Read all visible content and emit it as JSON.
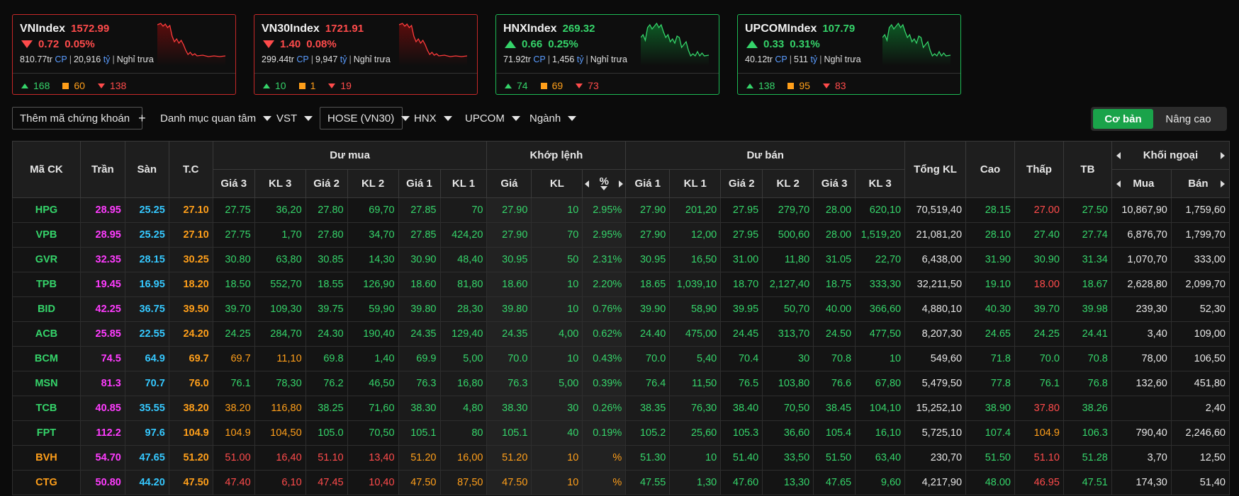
{
  "indices": [
    {
      "name": "VNIndex",
      "value": "1572.99",
      "change": "0.72",
      "pct": "0.05%",
      "dir": "down",
      "vol": "810.77tr",
      "cp": "CP",
      "val": "20,916",
      "unit": "tỷ",
      "status": "Nghỉ trưa",
      "up": "168",
      "flat": "60",
      "down": "138"
    },
    {
      "name": "VN30Index",
      "value": "1721.91",
      "change": "1.40",
      "pct": "0.08%",
      "dir": "down",
      "vol": "299.44tr",
      "cp": "CP",
      "val": "9,947",
      "unit": "tỷ",
      "status": "Nghỉ trưa",
      "up": "10",
      "flat": "1",
      "down": "19"
    },
    {
      "name": "HNXIndex",
      "value": "269.32",
      "change": "0.66",
      "pct": "0.25%",
      "dir": "up",
      "vol": "71.92tr",
      "cp": "CP",
      "val": "1,456",
      "unit": "tỷ",
      "status": "Nghỉ trưa",
      "up": "74",
      "flat": "69",
      "down": "73"
    },
    {
      "name": "UPCOMIndex",
      "value": "107.79",
      "change": "0.33",
      "pct": "0.31%",
      "dir": "up",
      "vol": "40.12tr",
      "cp": "CP",
      "val": "511",
      "unit": "tỷ",
      "status": "Nghỉ trưa",
      "up": "138",
      "flat": "95",
      "down": "83"
    }
  ],
  "toolbar": {
    "add": "Thêm mã chứng khoán",
    "watch": "Danh mục quan tâm",
    "vst": "VST",
    "hose": "HOSE (VN30)",
    "hnx": "HNX",
    "upcom": "UPCOM",
    "sector": "Ngành",
    "basic": "Cơ bản",
    "advanced": "Nâng cao"
  },
  "headers": {
    "symbol": "Mã CK",
    "ceil": "Trần",
    "floor": "Sàn",
    "ref": "T.C",
    "buy": "Dư mua",
    "match": "Khớp lệnh",
    "sell": "Dư bán",
    "total": "Tổng KL",
    "high": "Cao",
    "low": "Thấp",
    "avg": "TB",
    "foreign": "Khối ngoại",
    "p3": "Giá 3",
    "v3": "KL 3",
    "p2": "Giá 2",
    "v2": "KL 2",
    "p1": "Giá 1",
    "v1": "KL 1",
    "mp": "Giá",
    "mv": "KL",
    "pct": "%",
    "fbuy": "Mua",
    "fsell": "Bán"
  },
  "colors": {
    "ceil": "#ff3cff",
    "floor": "#35c8ff",
    "ref": "#ff9f1a",
    "up": "#35d46a",
    "down": "#ff4b4b"
  },
  "rows": [
    {
      "sym": "HPG",
      "c": "28.95",
      "f": "25.25",
      "r": "27.10",
      "b3": "27.75",
      "bv3": "36,20",
      "b2": "27.80",
      "bv2": "69,70",
      "b1": "27.85",
      "bv1": "70",
      "mp": "27.90",
      "mv": "10",
      "pct": "2.95%",
      "s1": "27.90",
      "sv1": "201,20",
      "s2": "27.95",
      "sv2": "279,70",
      "s3": "28.00",
      "sv3": "620,10",
      "tot": "70,519,40",
      "hi": "28.15",
      "lo": "27.00",
      "avg": "27.50",
      "fb": "10,867,90",
      "fs": "1,759,60",
      "col": [
        "u",
        "u",
        "u",
        "u",
        "u",
        "u",
        "u",
        "u",
        "u",
        "u",
        "u",
        "u",
        "u",
        "u",
        "u",
        "u",
        "u",
        "d",
        "u"
      ]
    },
    {
      "sym": "VPB",
      "c": "28.95",
      "f": "25.25",
      "r": "27.10",
      "b3": "27.75",
      "bv3": "1,70",
      "b2": "27.80",
      "bv2": "34,70",
      "b1": "27.85",
      "bv1": "424,20",
      "mp": "27.90",
      "mv": "70",
      "pct": "2.95%",
      "s1": "27.90",
      "sv1": "12,00",
      "s2": "27.95",
      "sv2": "500,60",
      "s3": "28.00",
      "sv3": "1,519,20",
      "tot": "21,081,20",
      "hi": "28.10",
      "lo": "27.40",
      "avg": "27.74",
      "col": [
        "u",
        "u",
        "u",
        "u",
        "u",
        "u",
        "u",
        "u",
        "u",
        "u",
        "u",
        "u",
        "u",
        "u",
        "u",
        "u",
        "u",
        "u",
        "u"
      ],
      "fb": "6,876,70",
      "fs": "1,799,70"
    },
    {
      "sym": "GVR",
      "c": "32.35",
      "f": "28.15",
      "r": "30.25",
      "b3": "30.80",
      "bv3": "63,80",
      "b2": "30.85",
      "bv2": "14,30",
      "b1": "30.90",
      "bv1": "48,40",
      "mp": "30.95",
      "mv": "50",
      "pct": "2.31%",
      "s1": "30.95",
      "sv1": "16,50",
      "s2": "31.00",
      "sv2": "11,80",
      "s3": "31.05",
      "sv3": "22,70",
      "tot": "6,438,00",
      "hi": "31.90",
      "lo": "30.90",
      "avg": "31.34",
      "fb": "1,070,70",
      "fs": "333,00",
      "col": [
        "u",
        "u",
        "u",
        "u",
        "u",
        "u",
        "u",
        "u",
        "u",
        "u",
        "u",
        "u",
        "u",
        "u",
        "u",
        "u",
        "u",
        "u",
        "u"
      ]
    },
    {
      "sym": "TPB",
      "c": "19.45",
      "f": "16.95",
      "r": "18.20",
      "b3": "18.50",
      "bv3": "552,70",
      "b2": "18.55",
      "bv2": "126,90",
      "b1": "18.60",
      "bv1": "81,80",
      "mp": "18.60",
      "mv": "10",
      "pct": "2.20%",
      "s1": "18.65",
      "sv1": "1,039,10",
      "s2": "18.70",
      "sv2": "2,127,40",
      "s3": "18.75",
      "sv3": "333,30",
      "tot": "32,211,50",
      "hi": "19.10",
      "lo": "18.00",
      "avg": "18.67",
      "fb": "2,628,80",
      "fs": "2,099,70",
      "col": [
        "u",
        "u",
        "u",
        "u",
        "u",
        "u",
        "u",
        "u",
        "u",
        "u",
        "u",
        "u",
        "u",
        "u",
        "u",
        "u",
        "u",
        "d",
        "u"
      ]
    },
    {
      "sym": "BID",
      "c": "42.25",
      "f": "36.75",
      "r": "39.50",
      "b3": "39.70",
      "bv3": "109,30",
      "b2": "39.75",
      "bv2": "59,90",
      "b1": "39.80",
      "bv1": "28,30",
      "mp": "39.80",
      "mv": "10",
      "pct": "0.76%",
      "s1": "39.90",
      "sv1": "58,90",
      "s2": "39.95",
      "sv2": "50,70",
      "s3": "40.00",
      "sv3": "366,60",
      "tot": "4,880,10",
      "hi": "40.30",
      "lo": "39.70",
      "avg": "39.98",
      "fb": "239,30",
      "fs": "52,30",
      "col": [
        "u",
        "u",
        "u",
        "u",
        "u",
        "u",
        "u",
        "u",
        "u",
        "u",
        "u",
        "u",
        "u",
        "u",
        "u",
        "u",
        "u",
        "u",
        "u"
      ]
    },
    {
      "sym": "ACB",
      "c": "25.85",
      "f": "22.55",
      "r": "24.20",
      "b3": "24.25",
      "bv3": "284,70",
      "b2": "24.30",
      "bv2": "190,40",
      "b1": "24.35",
      "bv1": "129,40",
      "mp": "24.35",
      "mv": "4,00",
      "pct": "0.62%",
      "s1": "24.40",
      "sv1": "475,00",
      "s2": "24.45",
      "sv2": "313,70",
      "s3": "24.50",
      "sv3": "477,50",
      "tot": "8,207,30",
      "hi": "24.65",
      "lo": "24.25",
      "avg": "24.41",
      "fb": "3,40",
      "fs": "109,00",
      "col": [
        "u",
        "u",
        "u",
        "u",
        "u",
        "u",
        "u",
        "u",
        "u",
        "u",
        "u",
        "u",
        "u",
        "u",
        "u",
        "u",
        "u",
        "u",
        "u"
      ]
    },
    {
      "sym": "BCM",
      "c": "74.5",
      "f": "64.9",
      "r": "69.7",
      "b3": "69.7",
      "bv3": "11,10",
      "b2": "69.8",
      "bv2": "1,40",
      "b1": "69.9",
      "bv1": "5,00",
      "mp": "70.0",
      "mv": "10",
      "pct": "0.43%",
      "s1": "70.0",
      "sv1": "5,40",
      "s2": "70.4",
      "sv2": "30",
      "s3": "70.8",
      "sv3": "10",
      "tot": "549,60",
      "hi": "71.8",
      "lo": "70.0",
      "avg": "70.8",
      "fb": "78,00",
      "fs": "106,50",
      "col": [
        "r",
        "r",
        "u",
        "u",
        "u",
        "u",
        "u",
        "u",
        "u",
        "u",
        "u",
        "u",
        "u",
        "u",
        "u",
        "u",
        "u",
        "u",
        "u"
      ]
    },
    {
      "sym": "MSN",
      "c": "81.3",
      "f": "70.7",
      "r": "76.0",
      "b3": "76.1",
      "bv3": "78,30",
      "b2": "76.2",
      "bv2": "46,50",
      "b1": "76.3",
      "bv1": "16,80",
      "mp": "76.3",
      "mv": "5,00",
      "pct": "0.39%",
      "s1": "76.4",
      "sv1": "11,50",
      "s2": "76.5",
      "sv2": "103,80",
      "s3": "76.6",
      "sv3": "67,80",
      "tot": "5,479,50",
      "hi": "77.8",
      "lo": "76.1",
      "avg": "76.8",
      "fb": "132,60",
      "fs": "451,80",
      "col": [
        "u",
        "u",
        "u",
        "u",
        "u",
        "u",
        "u",
        "u",
        "u",
        "u",
        "u",
        "u",
        "u",
        "u",
        "u",
        "u",
        "u",
        "u",
        "u"
      ]
    },
    {
      "sym": "TCB",
      "c": "40.85",
      "f": "35.55",
      "r": "38.20",
      "b3": "38.20",
      "bv3": "116,80",
      "b2": "38.25",
      "bv2": "71,60",
      "b1": "38.30",
      "bv1": "4,80",
      "mp": "38.30",
      "mv": "30",
      "pct": "0.26%",
      "s1": "38.35",
      "sv1": "76,30",
      "s2": "38.40",
      "sv2": "70,50",
      "s3": "38.45",
      "sv3": "104,10",
      "tot": "15,252,10",
      "hi": "38.90",
      "lo": "37.80",
      "avg": "38.26",
      "fb": "",
      "fs": "2,40",
      "col": [
        "r",
        "r",
        "u",
        "u",
        "u",
        "u",
        "u",
        "u",
        "u",
        "u",
        "u",
        "u",
        "u",
        "u",
        "u",
        "u",
        "u",
        "d",
        "u"
      ]
    },
    {
      "sym": "FPT",
      "c": "112.2",
      "f": "97.6",
      "r": "104.9",
      "b3": "104.9",
      "bv3": "104,50",
      "b2": "105.0",
      "bv2": "70,50",
      "b1": "105.1",
      "bv1": "80",
      "mp": "105.1",
      "mv": "40",
      "pct": "0.19%",
      "s1": "105.2",
      "sv1": "25,60",
      "s2": "105.3",
      "sv2": "36,60",
      "s3": "105.4",
      "sv3": "16,10",
      "tot": "5,725,10",
      "hi": "107.4",
      "lo": "104.9",
      "avg": "106.3",
      "fb": "790,40",
      "fs": "2,246,60",
      "col": [
        "r",
        "r",
        "u",
        "u",
        "u",
        "u",
        "u",
        "u",
        "u",
        "u",
        "u",
        "u",
        "u",
        "u",
        "u",
        "u",
        "u",
        "r",
        "u"
      ]
    },
    {
      "sym": "BVH",
      "c": "54.70",
      "f": "47.65",
      "r": "51.20",
      "b3": "51.00",
      "bv3": "16,40",
      "b2": "51.10",
      "bv2": "13,40",
      "b1": "51.20",
      "bv1": "16,00",
      "mp": "51.20",
      "mv": "10",
      "pct": "%",
      "s1": "51.30",
      "sv1": "10",
      "s2": "51.40",
      "sv2": "33,50",
      "s3": "51.50",
      "sv3": "63,40",
      "tot": "230,70",
      "hi": "51.50",
      "lo": "51.10",
      "avg": "51.28",
      "fb": "3,70",
      "fs": "12,50",
      "col": [
        "d",
        "d",
        "d",
        "d",
        "r",
        "r",
        "r",
        "r",
        "r",
        "u",
        "u",
        "u",
        "u",
        "u",
        "u",
        "u",
        "u",
        "d",
        "u"
      ]
    },
    {
      "sym": "CTG",
      "c": "50.80",
      "f": "44.20",
      "r": "47.50",
      "b3": "47.40",
      "bv3": "6,10",
      "b2": "47.45",
      "bv2": "10,40",
      "b1": "47.50",
      "bv1": "87,50",
      "mp": "47.50",
      "mv": "10",
      "pct": "%",
      "s1": "47.55",
      "sv1": "1,30",
      "s2": "47.60",
      "sv2": "13,30",
      "s3": "47.65",
      "sv3": "9,60",
      "tot": "4,217,90",
      "hi": "48.00",
      "lo": "46.95",
      "avg": "47.51",
      "fb": "174,30",
      "fs": "51,40",
      "col": [
        "d",
        "d",
        "d",
        "d",
        "r",
        "r",
        "r",
        "r",
        "r",
        "u",
        "u",
        "u",
        "u",
        "u",
        "u",
        "u",
        "u",
        "d",
        "u"
      ]
    }
  ]
}
